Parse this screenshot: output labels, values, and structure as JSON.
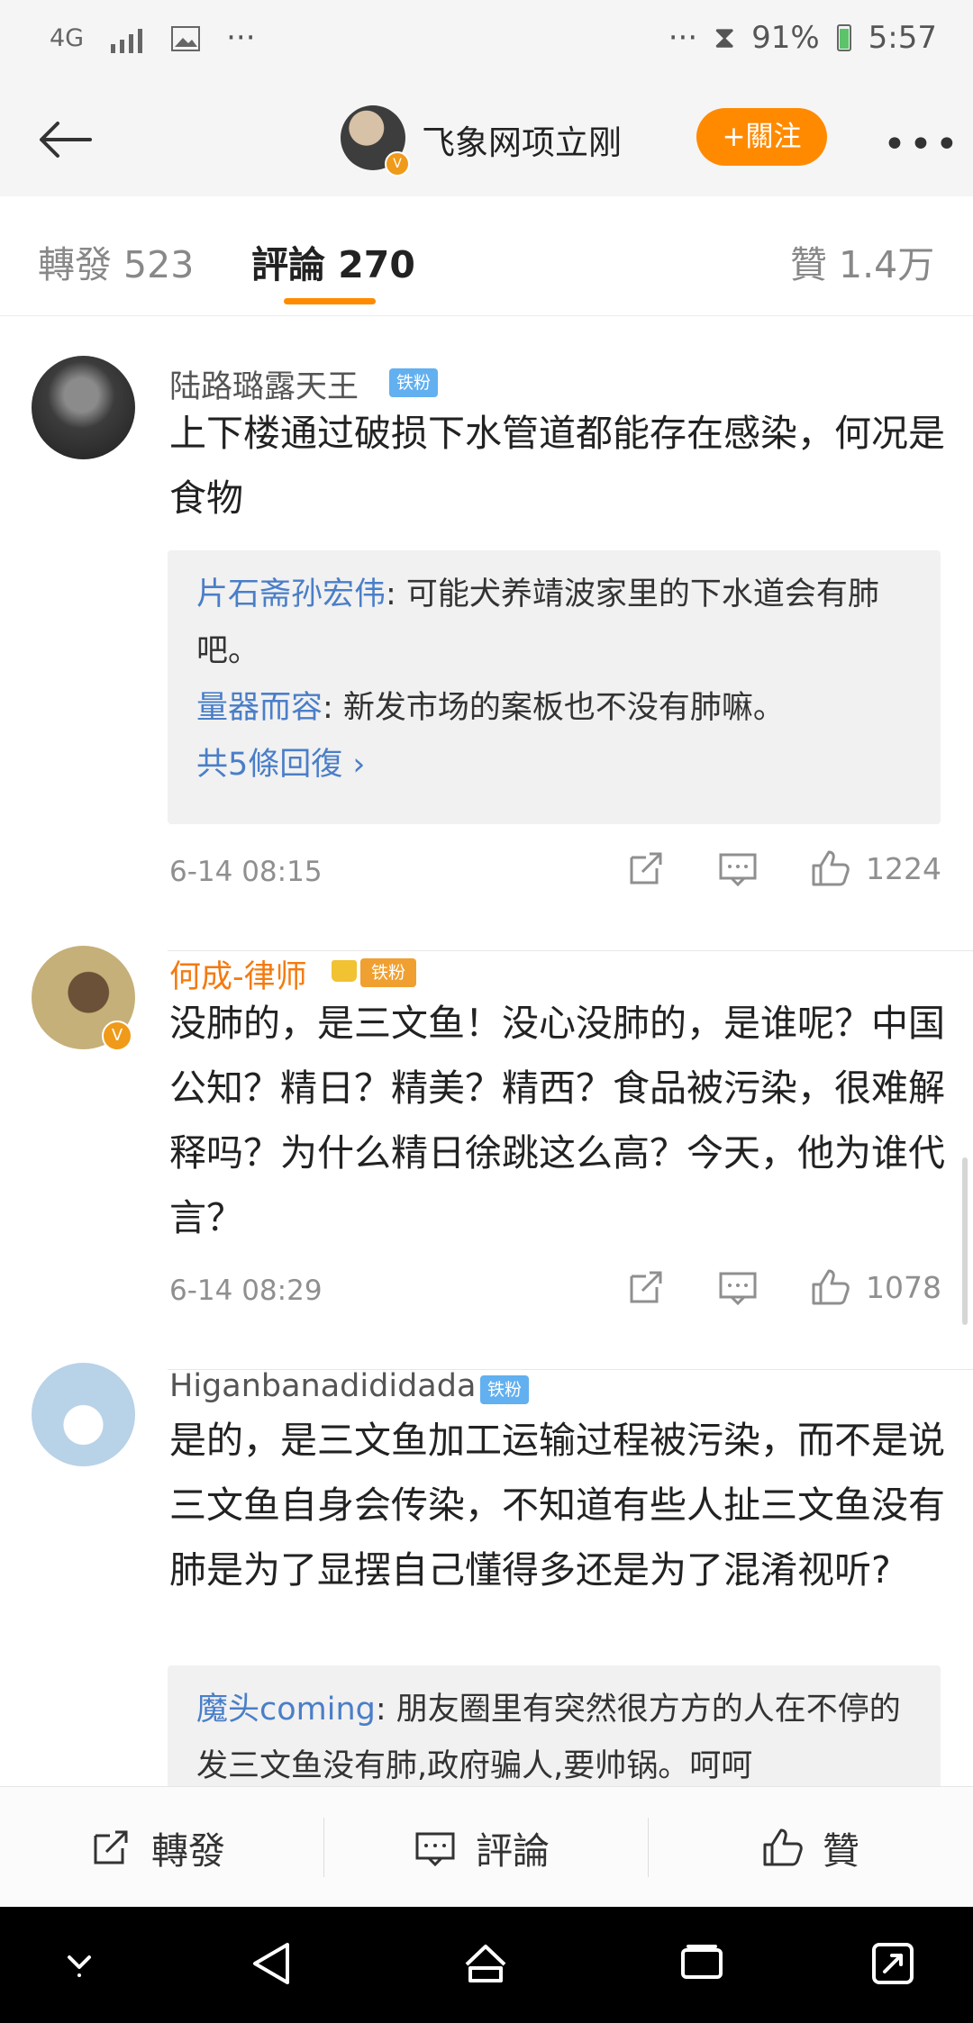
{
  "status": {
    "network": "4G",
    "battery_percent": "91%",
    "time": "5:57",
    "dots_left": "···",
    "dots_right": "···"
  },
  "header": {
    "title": "飞象网项立刚",
    "follow_label": "+關注"
  },
  "tabs": [
    {
      "label": "轉發 523"
    },
    {
      "label": "評論 270"
    },
    {
      "label": "贊 1.4万"
    }
  ],
  "comments": [
    {
      "username": "陆路璐露天王",
      "tag": "铁粉",
      "content": "上下楼通过破损下水管道都能存在感染，何况是食物",
      "replies": [
        {
          "name": "片石斋孙宏伟",
          "text": ": 可能犬养靖波家里的下水道会有肺吧。"
        },
        {
          "name": "量器而容",
          "text": ": 新发市场的案板也不没有肺嘛。"
        }
      ],
      "more_replies": "共5條回復 ›",
      "date": "6-14 08:15",
      "likes": "1224"
    },
    {
      "username": "何成-律师",
      "tag": "铁粉",
      "content": "没肺的，是三文鱼！没心没肺的，是谁呢？中国公知？精日？精美？精西？食品被污染，很难解释吗？为什么精日徐跳这么高？今天，他为谁代言？",
      "date": "6-14 08:29",
      "likes": "1078"
    },
    {
      "username": "Higanbanadididada",
      "tag": "铁粉",
      "content": "是的，是三文鱼加工运输过程被污染，而不是说三文鱼自身会传染，不知道有些人扯三文鱼没有肺是为了显摆自己懂得多还是为了混淆视听?",
      "replies": [
        {
          "name": "魔头coming",
          "text": ": 朋友圈里有突然很方方的人在不停的发三文鱼没有肺,政府骗人,要帅锅。呵呵"
        }
      ]
    }
  ],
  "bottom": {
    "repost": "轉發",
    "comment": "評論",
    "like": "贊"
  },
  "icons": {
    "back": "back-arrow-icon",
    "more": "more-icon",
    "share": "share-icon",
    "comment": "comment-icon",
    "like": "like-icon"
  },
  "colors": {
    "accent": "#ff8a00",
    "link": "#4a7ec8",
    "vip_name": "#f47a0f"
  }
}
